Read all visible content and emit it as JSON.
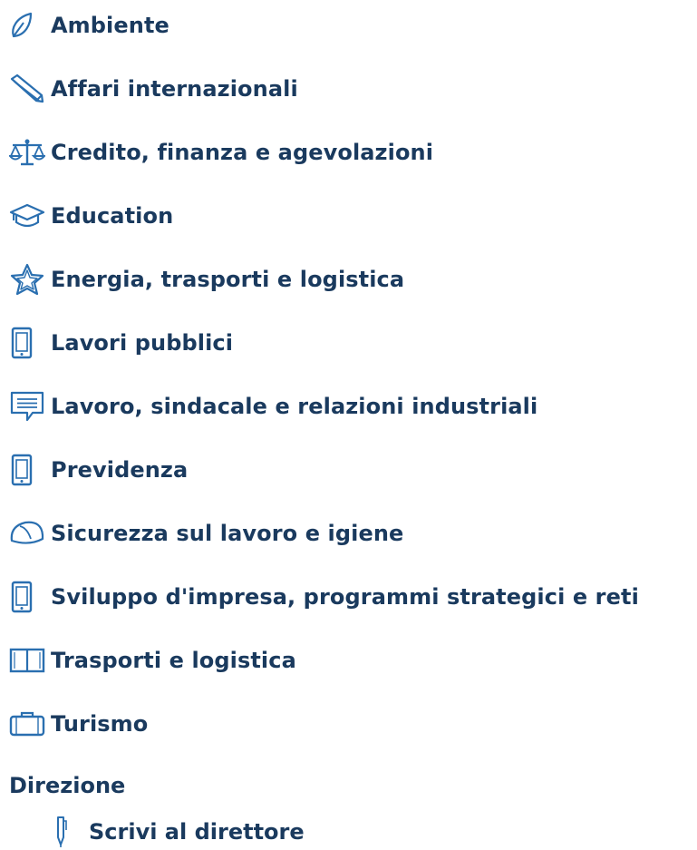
{
  "menu": {
    "items": [
      {
        "label": "Ambiente",
        "icon": "leaf-icon"
      },
      {
        "label": "Affari internazionali",
        "icon": "pencil-icon"
      },
      {
        "label": "Credito, finanza e agevolazioni",
        "icon": "scales-icon"
      },
      {
        "label": "Education",
        "icon": "graduation-cap-icon"
      },
      {
        "label": "Energia, trasporti e logistica",
        "icon": "star-icon"
      },
      {
        "label": "Lavori pubblici",
        "icon": "smartphone-icon"
      },
      {
        "label": "Lavoro, sindacale e relazioni industriali",
        "icon": "chat-bubble-icon"
      },
      {
        "label": "Previdenza",
        "icon": "smartphone-icon"
      },
      {
        "label": "Sicurezza sul lavoro e igiene",
        "icon": "hard-hat-icon"
      },
      {
        "label": "Sviluppo d'impresa, programmi strategici e reti",
        "icon": "smartphone-icon"
      },
      {
        "label": "Trasporti e logistica",
        "icon": "book-icon"
      },
      {
        "label": "Turismo",
        "icon": "suitcase-icon"
      }
    ]
  },
  "direzione": {
    "heading": "Direzione",
    "items": [
      {
        "label": "Scrivi al direttore",
        "icon": "pen-icon"
      }
    ]
  },
  "colors": {
    "text": "#1a3a5e",
    "icon": "#2a6fb0"
  }
}
